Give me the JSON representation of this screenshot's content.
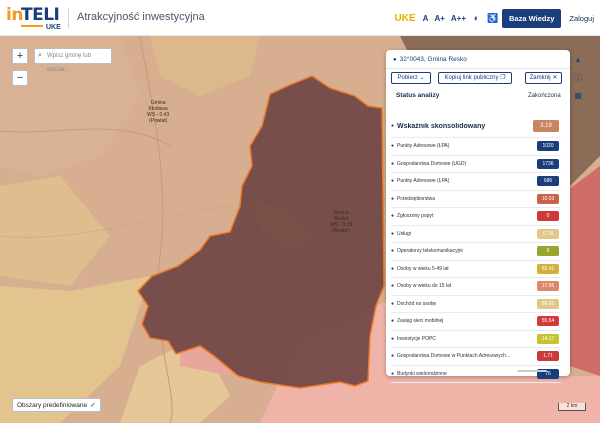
{
  "header": {
    "logo_in": "in",
    "logo_teli": "TELI",
    "logo_uke": "UKE",
    "title": "Atrakcyjność inwestycyjna",
    "uke_mark": "UKE",
    "font_small": "A",
    "font_medium": "A+",
    "font_large": "A++",
    "contrast_icon": "contrast-icon",
    "accessibility_icon": "accessibility-icon",
    "knowledge_base": "Baza Wiedzy",
    "login": "Zaloguj"
  },
  "map": {
    "zoom_in": "+",
    "zoom_out": "−",
    "search_placeholder": "Wpisz gminę lub obszar...",
    "label_west": [
      "Gmina",
      "Kłodawa",
      "WS - 0.43",
      "(Powiat)"
    ],
    "label_center": [
      "Gmina",
      "Resko",
      "WS - 3.19",
      "(Resko)"
    ],
    "predefined_areas": "Obszary predefiniowane",
    "scale": "2 km",
    "colors": {
      "base": "#d7ae8f",
      "sand": "#e3c48f",
      "dark": "#8a6c57",
      "pink": "#efb3a7",
      "selected": "#6f4543",
      "border": "#f07a2a"
    }
  },
  "panel": {
    "title": "32°0043, Gmina Resko",
    "download": "Pobierz",
    "copy_link": "Kopiuj link publiczny",
    "close": "Zamknij",
    "col_status": "Status analizy",
    "col_done": "Zakończona",
    "rows": [
      {
        "label": "Wskaźnik skonsolidowany",
        "value": "3.19",
        "color": "#c9855f",
        "main": true
      },
      {
        "label": "Punkty Adresowe (ŁPA)",
        "value": "1020",
        "color": "#1a3d7c"
      },
      {
        "label": "Gospodarstwa Domowe (UGD)",
        "value": "1736",
        "color": "#1a3d7c"
      },
      {
        "label": "Punkty Adresowe (LPA)",
        "value": "686",
        "color": "#1a3d7c"
      },
      {
        "label": "Przedsiębiorstwa",
        "value": "10.03",
        "color": "#c9634a"
      },
      {
        "label": "Zgłoszony popyt",
        "value": "0",
        "color": "#d03a3a"
      },
      {
        "label": "Usługi",
        "value": "0.78",
        "color": "#e0c88a"
      },
      {
        "label": "Operatorzy telekomunikacyjni",
        "value": "6",
        "color": "#9aa52e"
      },
      {
        "label": "Osoby w wieku 5-49 lat",
        "value": "65.41",
        "color": "#d4b13a"
      },
      {
        "label": "Osoby w wieku do 15 lat",
        "value": "17.56",
        "color": "#e0876a"
      },
      {
        "label": "Dochód na osobę",
        "value": "66.01",
        "color": "#e0c88a"
      },
      {
        "label": "Zasięg sieci mobilnej",
        "value": "55.54",
        "color": "#d03a3a"
      },
      {
        "label": "Inwestycje POPC",
        "value": "14.17",
        "color": "#c9c22c"
      },
      {
        "label": "Gospodarstwa Domowe w Punktach Adresowych...",
        "value": "1.71",
        "color": "#c93a3a"
      },
      {
        "label": "Budynki wielorodzinne",
        "value": "75",
        "color": "#1a3d7c"
      }
    ]
  },
  "side_icons": [
    "chart-icon",
    "info-icon",
    "map-icon"
  ]
}
